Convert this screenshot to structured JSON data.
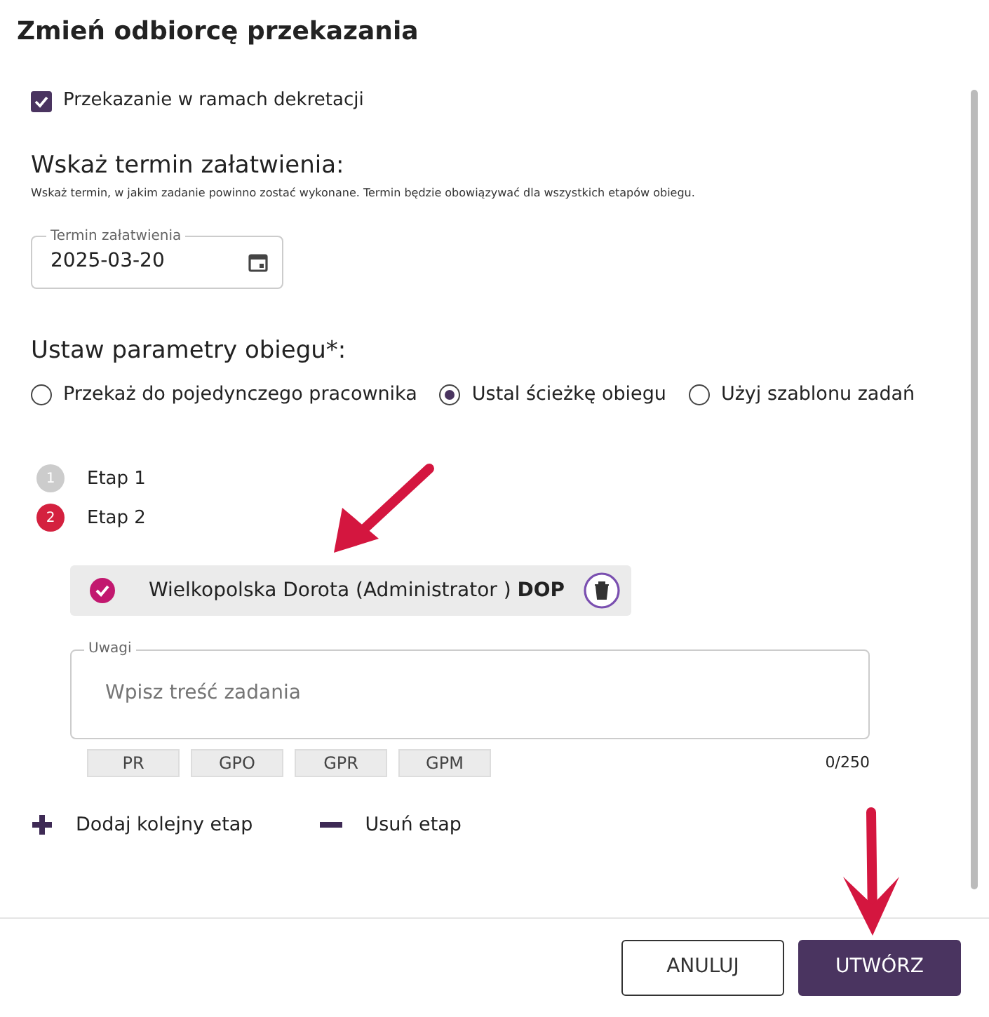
{
  "dialog": {
    "title": "Zmień odbiorcę przekazania"
  },
  "decree_checkbox": {
    "label": "Przekazanie w ramach dekretacji",
    "checked": true
  },
  "deadline": {
    "heading": "Wskaż termin załatwienia:",
    "hint": "Wskaż termin, w jakim zadanie powinno zostać wykonane. Termin będzie obowiązywać dla wszystkich etapów obiegu.",
    "field_label": "Termin załatwienia",
    "value": "2025-03-20"
  },
  "routing": {
    "heading": "Ustaw parametry obiegu*:",
    "options": [
      {
        "label": "Przekaż do pojedynczego pracownika",
        "selected": false
      },
      {
        "label": "Ustal ścieżkę obiegu",
        "selected": true
      },
      {
        "label": "Użyj szablonu zadań",
        "selected": false
      }
    ]
  },
  "steps": [
    {
      "number": "1",
      "label": "Etap 1",
      "selected": false
    },
    {
      "number": "2",
      "label": "Etap 2",
      "selected": true
    }
  ],
  "recipient": {
    "name": "Wielkopolska Dorota (Administrator )",
    "code": "DOP",
    "checked": true
  },
  "notes": {
    "label": "Uwagi",
    "placeholder": "Wpisz treść zadania",
    "counter": "0/250",
    "tags": [
      "PR",
      "GPO",
      "GPR",
      "GPM"
    ]
  },
  "step_actions": [
    {
      "kind": "add",
      "label": "Dodaj kolejny etap"
    },
    {
      "kind": "remove",
      "label": "Usuń etap"
    }
  ],
  "buttons": [
    {
      "kind": "secondary",
      "label": "ANULUJ"
    },
    {
      "kind": "primary",
      "label": "UTWÓRZ"
    }
  ]
}
